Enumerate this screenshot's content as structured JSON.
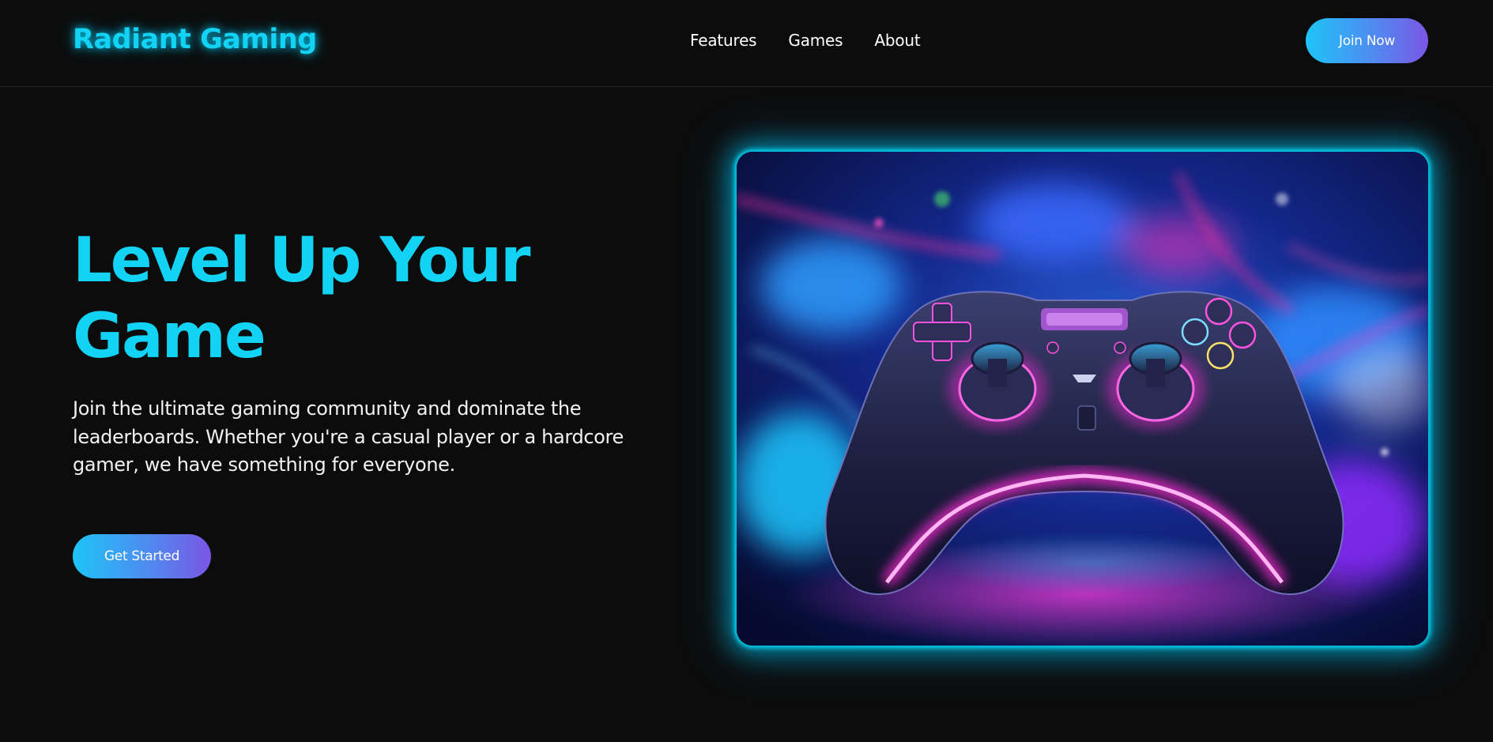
{
  "header": {
    "logo": "Radiant Gaming",
    "nav": [
      {
        "label": "Features"
      },
      {
        "label": "Games"
      },
      {
        "label": "About"
      }
    ],
    "join_label": "Join Now"
  },
  "hero": {
    "title": "Level Up Your Game",
    "description": "Join the ultimate gaming community and dominate the leaderboards. Whether you're a casual player or a hardcore gamer, we have something for everyone.",
    "cta_label": "Get Started",
    "image_icon": "gamepad-icon"
  },
  "colors": {
    "background": "#0c0c0c",
    "accent_cyan": "#12d3f3",
    "gradient_start": "#1ec4f8",
    "gradient_end": "#7a56e4",
    "neon_magenta": "#ff2bd6"
  }
}
